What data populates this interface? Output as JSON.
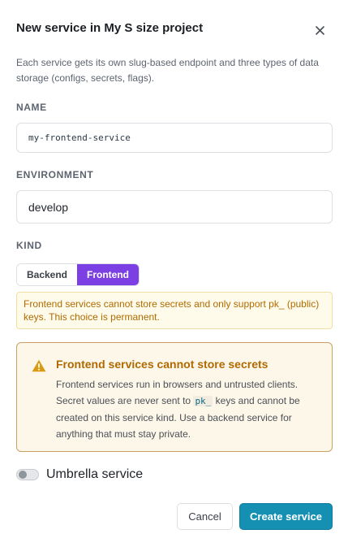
{
  "dialog": {
    "title": "New service in My S size project",
    "description": "Each service gets its own slug-based endpoint and three types of data storage (configs, secrets, flags)."
  },
  "fields": {
    "name_label": "NAME",
    "name_value": "my-frontend-service",
    "environment_label": "ENVIRONMENT",
    "environment_value": "develop",
    "kind_label": "KIND",
    "kind_options": [
      "Backend",
      "Frontend"
    ],
    "kind_selected": "Frontend"
  },
  "hint": {
    "text": "Frontend services cannot store secrets and only support pk_ (public) keys. This choice is permanent."
  },
  "alert": {
    "title": "Frontend services cannot store secrets",
    "body_before": "Frontend services run in browsers and untrusted clients. Secret values are never sent to ",
    "body_code": "pk_",
    "body_after": " keys and cannot be created on this service kind. Use a backend service for anything that must stay private.",
    "icon": "warning-icon"
  },
  "umbrella": {
    "label": "Umbrella service",
    "enabled": false
  },
  "actions": {
    "cancel_label": "Cancel",
    "create_label": "Create service"
  },
  "colors": {
    "accent_purple": "#7b3fe4",
    "primary_teal": "#1590b3",
    "warning_amber": "#b06a00"
  }
}
